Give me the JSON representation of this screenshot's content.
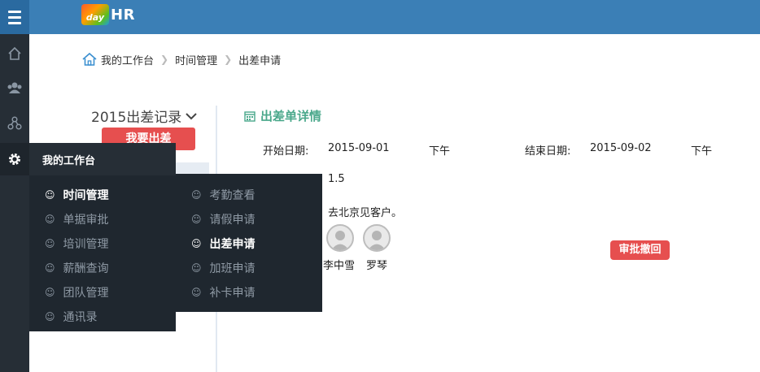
{
  "header": {
    "logo_badge": "day",
    "logo_text": "HR"
  },
  "rail": {
    "icons": [
      "home-icon",
      "users-icon",
      "org-icon",
      "gear-icon"
    ]
  },
  "breadcrumb": {
    "items": [
      "我的工作台",
      "时间管理",
      "出差申请"
    ],
    "separator": "❯"
  },
  "sidebar_panel": {
    "record_title": "2015出差记录",
    "apply_button": "我要出差"
  },
  "detail": {
    "title": "出差单详情",
    "start_label": "开始日期:",
    "start_date": "2015-09-01",
    "start_period": "下午",
    "end_label": "结束日期:",
    "end_date": "2015-09-02",
    "end_period": "下午",
    "days": "1.5",
    "reason": "去北京见客户。",
    "approvers": [
      "李中雪",
      "罗琴"
    ],
    "status_badge": "审批撤回"
  },
  "flyout": {
    "heading": "我的工作台",
    "column1": [
      "时间管理",
      "单据审批",
      "培训管理",
      "薪酬查询",
      "团队管理",
      "通讯录"
    ],
    "column2": [
      "考勤查看",
      "请假申请",
      "出差申请",
      "加班申请",
      "补卡申请"
    ],
    "current_col1": "时间管理",
    "current_col2": "出差申请",
    "item_glyph": "☺"
  },
  "colors": {
    "topbar": "#3b7fb6",
    "rail": "#262e36",
    "accent_green": "#4aa88b",
    "danger": "#e64f4f"
  }
}
